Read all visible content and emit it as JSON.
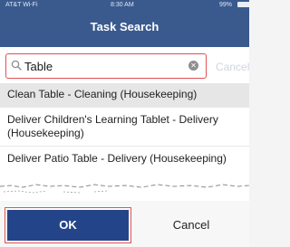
{
  "status_bar": {
    "carrier": "AT&T Wi-Fi",
    "time": "8:30 AM",
    "battery": "99%"
  },
  "header": {
    "title": "Task Search"
  },
  "search": {
    "value": "Table",
    "cancel_label": "Cancel"
  },
  "results": [
    {
      "label": "Clean Table - Cleaning (Housekeeping)"
    },
    {
      "label": "Deliver Children's Learning Tablet - Delivery (Housekeeping)"
    },
    {
      "label": "Deliver Patio Table - Delivery (Housekeeping)"
    }
  ],
  "footer": {
    "ok_label": "OK",
    "cancel_label": "Cancel"
  },
  "colors": {
    "header_bg": "#3a5a8e",
    "ok_button_bg": "#24448a",
    "highlight_border": "#e05252",
    "selected_row_bg": "#e6e6e6"
  }
}
